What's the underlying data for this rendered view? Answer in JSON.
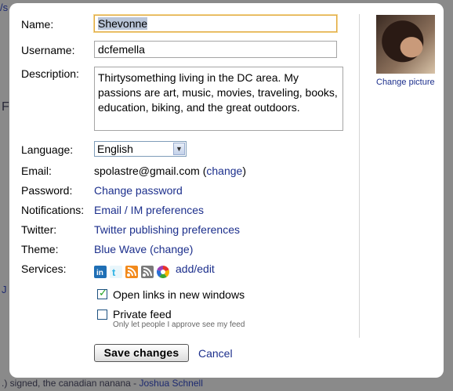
{
  "background": {
    "top_link_fragment": "/s",
    "side_fragment": "F",
    "left_link_fragment": "J",
    "bottom_line_text": ".) signed, the canadian nanana -",
    "bottom_line_link": "Joshua Schnell"
  },
  "form": {
    "name": {
      "label": "Name:",
      "value": "Shevonne"
    },
    "username": {
      "label": "Username:",
      "value": "dcfemella"
    },
    "description": {
      "label": "Description:",
      "value": "Thirtysomething living in the DC area. My passions are art, music, movies, traveling, books, education, biking, and the great outdoors."
    },
    "language": {
      "label": "Language:",
      "selected": "English"
    },
    "email": {
      "label": "Email:",
      "value": "spolastre@gmail.com",
      "open_paren": "(",
      "change_link": "change",
      "close_paren": ")"
    },
    "password": {
      "label": "Password:",
      "link": "Change password"
    },
    "notifications": {
      "label": "Notifications:",
      "link": "Email / IM preferences"
    },
    "twitter": {
      "label": "Twitter:",
      "link": "Twitter publishing preferences"
    },
    "theme": {
      "label": "Theme:",
      "value_link": "Blue Wave",
      "open_paren": "(",
      "change_link": "change",
      "close_paren": ")"
    },
    "services": {
      "label": "Services:",
      "icons": [
        "linkedin-icon",
        "twitter-icon",
        "rss-feed-icon",
        "blog-feed-icon",
        "picasa-icon"
      ],
      "link": "add/edit"
    },
    "open_links": {
      "label": "Open links in new windows",
      "checked": true
    },
    "private_feed": {
      "label": "Private feed",
      "checked": false,
      "hint": "Only let people I approve see my feed"
    },
    "save_button": "Save changes",
    "cancel_link": "Cancel"
  },
  "profile_picture": {
    "change_link": "Change picture"
  },
  "colors": {
    "link": "#1c2f8c",
    "focus_border": "#e0a83c",
    "overlay": "#8a8a8a"
  }
}
